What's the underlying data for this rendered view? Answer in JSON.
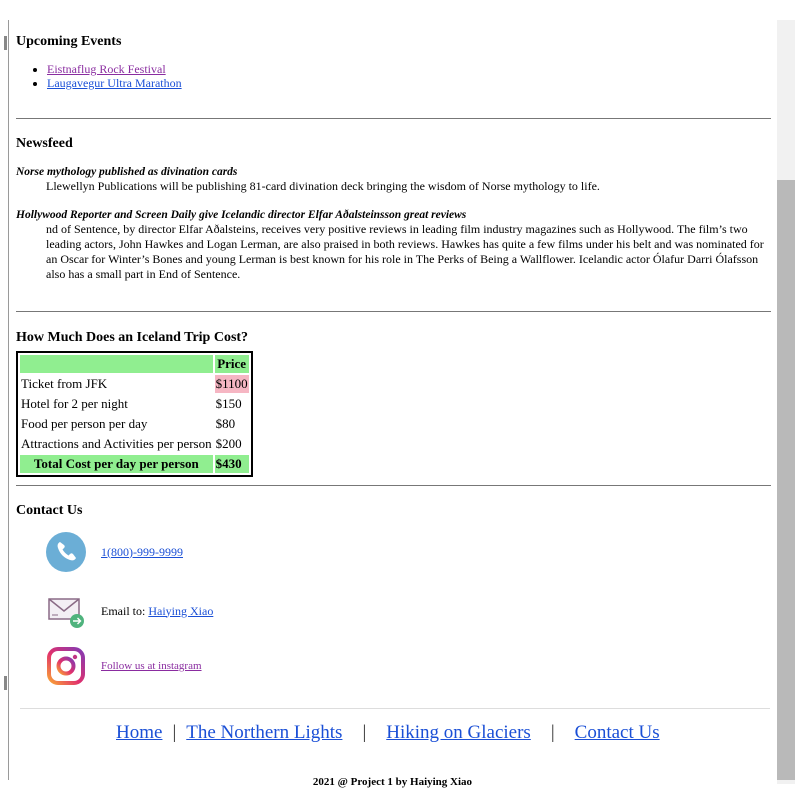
{
  "events": {
    "title": "Upcoming Events",
    "items": [
      {
        "label": "Eistnaflug Rock Festival"
      },
      {
        "label": "Laugavegur Ultra Marathon"
      }
    ]
  },
  "newsfeed": {
    "title": "Newsfeed",
    "items": [
      {
        "headline": "Norse mythology published as divination cards",
        "body": "Llewellyn Publications will be publishing 81-card divination deck bringing the wisdom of Norse mythology to life."
      },
      {
        "headline": "Hollywood Reporter and Screen Daily give Icelandic director Elfar Aðalsteinsson great reviews",
        "body": "nd of Sentence, by director Elfar Aðalsteins, receives very positive reviews in leading film industry magazines such as Hollywood. The film’s two leading actors, John Hawkes and Logan Lerman, are also praised in both reviews. Hawkes has quite a few films under his belt and was nominated for an Oscar for Winter’s Bones and young Lerman is best known for his role in The Perks of Being a Wallflower. Icelandic actor Ólafur Darri Ólafsson also has a small part in End of Sentence."
      }
    ]
  },
  "cost": {
    "title": "How Much Does an Iceland Trip Cost?",
    "header_price": "Price",
    "rows": [
      {
        "item": "Ticket from JFK",
        "price": "$1100"
      },
      {
        "item": "Hotel for 2 per night",
        "price": "$150"
      },
      {
        "item": "Food per person per day",
        "price": "$80"
      },
      {
        "item": "Attractions and Activities per person",
        "price": "$200"
      }
    ],
    "total_label": "Total Cost per day per person",
    "total_value": "$430"
  },
  "contact": {
    "title": "Contact Us",
    "phone": "1(800)-999-9999",
    "email_prefix": "Email to:",
    "email_name": "Haiying Xiao",
    "instagram": "Follow us at instagram"
  },
  "footer": {
    "nav": [
      {
        "label": "Home"
      },
      {
        "label": "The Northern Lights"
      },
      {
        "label": "Hiking on Glaciers"
      },
      {
        "label": "Contact Us"
      }
    ],
    "separator": "|",
    "credit": "2021 @ Project 1 by Haiying Xiao"
  },
  "colors": {
    "table_green": "#90ee90",
    "highlight_pink": "#f6b6c3",
    "link": "#1a4fd6",
    "visited_link": "#8a2ca0",
    "phone_icon": "#6baed6"
  },
  "icons": [
    "phone-icon",
    "email-icon",
    "instagram-icon"
  ]
}
